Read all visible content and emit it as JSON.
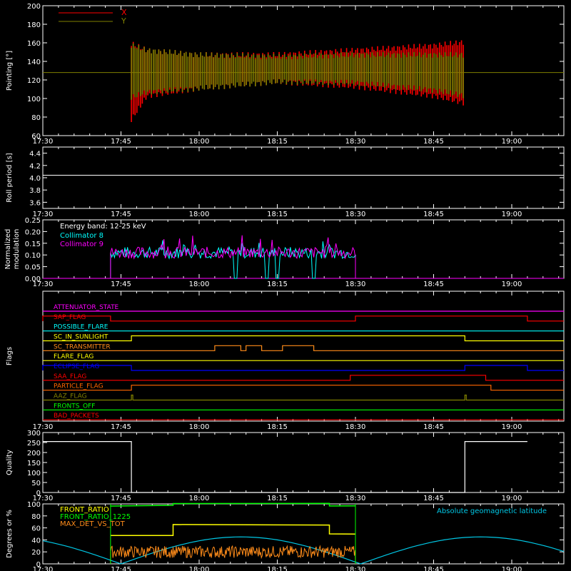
{
  "colors": {
    "background": "#000000",
    "axis": "#ffffff",
    "x_pointing": "#ff0000",
    "y_pointing": "#808000",
    "collimator8": "#00ffff",
    "collimator9": "#ff00ff",
    "geomag": "#00c8e6"
  },
  "time_axis": {
    "range": [
      "17:30",
      "19:00+"
    ],
    "ticks": [
      "17:30",
      "17:45",
      "18:00",
      "18:15",
      "18:30",
      "18:45",
      "19:00"
    ]
  },
  "chart_data": [
    {
      "panel": "pointing",
      "type": "line",
      "ylabel": "Pointing [°]",
      "ylim": [
        60,
        200
      ],
      "yticks": [
        "60",
        "80",
        "100",
        "120",
        "140",
        "160",
        "180",
        "200"
      ],
      "legend": [
        "X",
        "Y"
      ],
      "legend_position": "top-left",
      "series": [
        {
          "name": "X",
          "color": "#ff0000",
          "x": [
            "17:47",
            "17:50",
            "18:00",
            "18:15",
            "18:30",
            "18:45",
            "18:51"
          ],
          "upper": [
            162,
            155,
            150,
            150,
            155,
            160,
            164
          ],
          "lower": [
            74,
            100,
            108,
            115,
            110,
            100,
            92
          ]
        },
        {
          "name": "Y",
          "color": "#808000",
          "x": [
            "17:47",
            "17:50",
            "18:00",
            "18:15",
            "18:30",
            "18:45",
            "18:51"
          ],
          "upper": [
            160,
            155,
            150,
            148,
            150,
            150,
            150
          ],
          "lower": [
            98,
            104,
            108,
            115,
            114,
            106,
            100
          ]
        }
      ],
      "baseline": 128
    },
    {
      "panel": "roll_period",
      "type": "line",
      "ylabel": "Roll period [s]",
      "ylim": [
        3.5,
        4.5
      ],
      "yticks": [
        "3.6",
        "3.8",
        "4.0",
        "4.2",
        "4.4"
      ],
      "series": [
        {
          "name": "",
          "color": "#ffffff",
          "constant": 4.04
        }
      ]
    },
    {
      "panel": "modulation",
      "type": "line",
      "ylabel": "Normalized modulation",
      "ylim": [
        0,
        0.25
      ],
      "yticks": [
        "0.00",
        "0.05",
        "0.10",
        "0.15",
        "0.20",
        "0.25"
      ],
      "annotation": "Energy band: 12-25 keV",
      "legend": [
        "Collimator 8",
        "Collimator 9"
      ],
      "series": [
        {
          "name": "Collimator 8",
          "color": "#00ffff",
          "active": [
            "17:43",
            "18:30"
          ],
          "mean": 0.11
        },
        {
          "name": "Collimator 9",
          "color": "#ff00ff",
          "active": [
            "17:43",
            "18:30"
          ],
          "mean": 0.11
        }
      ]
    },
    {
      "panel": "flags",
      "type": "line",
      "ylabel": "Flags",
      "series": [
        {
          "name": "ATTENUATOR_STATE",
          "color": "#ff00ff",
          "on": []
        },
        {
          "name": "SAP_FLAG",
          "color": "#ff0000",
          "on": [
            [
              "17:30",
              "17:43"
            ],
            [
              "18:30",
              "19:03"
            ]
          ]
        },
        {
          "name": "POSSIBLE_FLARE",
          "color": "#00ffff",
          "on": []
        },
        {
          "name": "SC_IN_SUNLIGHT",
          "color": "#ffff00",
          "on": [
            [
              "17:47",
              "18:51"
            ]
          ]
        },
        {
          "name": "SC_TRANSMITTER",
          "color": "#ff8c1a",
          "on": [
            [
              "18:03",
              "18:08"
            ],
            [
              "18:09",
              "18:12"
            ],
            [
              "18:16",
              "18:22"
            ]
          ]
        },
        {
          "name": "FLARE_FLAG",
          "color": "#ffff00",
          "on": []
        },
        {
          "name": "ECLIPSE_FLAG",
          "color": "#0000ff",
          "on": [
            [
              "17:30",
              "17:47"
            ],
            [
              "18:51",
              "19:03"
            ]
          ]
        },
        {
          "name": "SAA_FLAG",
          "color": "#ff0000",
          "on": [
            [
              "18:29",
              "18:55"
            ]
          ]
        },
        {
          "name": "PARTICLE_FLAG",
          "color": "#ff6600",
          "on": [
            [
              "17:47",
              "18:56"
            ]
          ]
        },
        {
          "name": "AAZ_FLAG",
          "color": "#808000",
          "on": [
            [
              "17:47",
              "17:47"
            ],
            [
              "18:51",
              "18:51"
            ]
          ]
        },
        {
          "name": "FRONTS_OFF",
          "color": "#00ff00",
          "on": []
        },
        {
          "name": "BAD_PACKETS",
          "color": "#ff0000",
          "on": []
        }
      ]
    },
    {
      "panel": "quality",
      "type": "line",
      "ylabel": "Quality",
      "ylim": [
        0,
        300
      ],
      "yticks": [
        "0",
        "50",
        "100",
        "150",
        "200",
        "250",
        "300"
      ],
      "series": [
        {
          "name": "",
          "color": "#ffffff",
          "x": [
            "17:30",
            "17:47",
            "17:47",
            "18:51",
            "18:51",
            "19:03"
          ],
          "y": [
            255,
            255,
            0,
            0,
            255,
            255
          ]
        }
      ]
    },
    {
      "panel": "ratios",
      "type": "line",
      "ylabel": "Degrees or %",
      "ylim": [
        0,
        100
      ],
      "yticks": [
        "0",
        "20",
        "40",
        "60",
        "80",
        "100"
      ],
      "legend": [
        "FRONT_RATIO",
        "FRONT_RATIO_1225",
        "MAX_DET_VS_TOT"
      ],
      "right_label": "Absolute geomagnetic latitude",
      "series": [
        {
          "name": "FRONT_RATIO",
          "color": "#ffff00",
          "x": [
            "17:43",
            "17:55",
            "17:55",
            "18:25",
            "18:25",
            "18:30"
          ],
          "y": [
            47,
            47,
            65,
            65,
            50,
            50
          ]
        },
        {
          "name": "FRONT_RATIO_1225",
          "color": "#00ff00",
          "x": [
            "17:43",
            "17:55",
            "17:55",
            "18:25",
            "18:25",
            "18:30"
          ],
          "y": [
            97,
            97,
            101,
            101,
            97,
            97
          ]
        },
        {
          "name": "MAX_DET_VS_TOT",
          "color": "#ff8c1a",
          "x": [
            "17:43",
            "18:30"
          ],
          "mean": 20
        },
        {
          "name": "Absolute geomagnetic latitude",
          "color": "#00c8e6",
          "x": [
            "17:30",
            "17:45",
            "18:08",
            "18:31",
            "18:55",
            "19:03"
          ],
          "y": [
            37,
            0,
            45,
            0,
            45,
            35
          ]
        }
      ]
    }
  ]
}
